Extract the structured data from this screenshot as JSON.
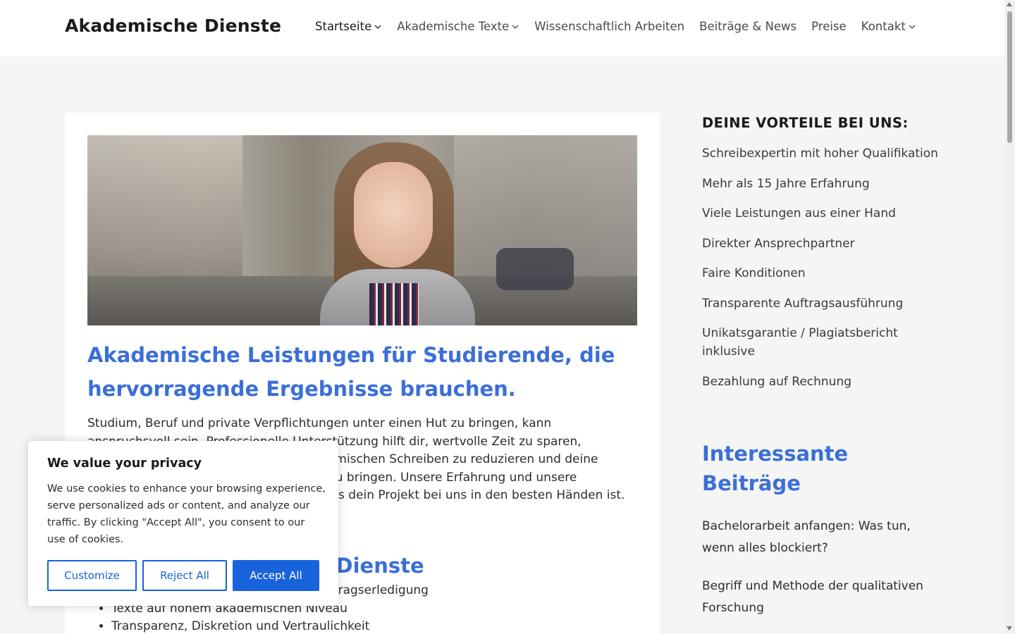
{
  "header": {
    "logo": "Akademische Dienste",
    "nav": [
      {
        "label": "Startseite",
        "has_dropdown": true,
        "active": true
      },
      {
        "label": "Akademische Texte",
        "has_dropdown": true,
        "active": false
      },
      {
        "label": "Wissenschaftlich Arbeiten",
        "has_dropdown": false,
        "active": false
      },
      {
        "label": "Beiträge & News",
        "has_dropdown": false,
        "active": false
      },
      {
        "label": "Preise",
        "has_dropdown": false,
        "active": false
      },
      {
        "label": "Kontakt",
        "has_dropdown": true,
        "active": false
      }
    ]
  },
  "main": {
    "title": "Akademische Leistungen für Studierende, die hervorragende Ergebnisse brauchen.",
    "intro": "Studium, Beruf und private Verpflichtungen unter einen Hut zu bringen, kann anspruchsvoll sein. Professionelle Unterstützung hilft dir, wertvolle Zeit zu sparen, Unsicherheiten und Schwachen im akademischen Schreiben zu reduzieren und deine Arbeit zuverlässig auf ein hohes Niveau zu bringen. Unsere Erfahrung und unsere fachkundige Begleitung sorgen dafür, dass dein Projekt bei uns in den besten Händen ist.",
    "section_heading": "Warum Akademische Dienste",
    "features": [
      "Termingerechte und zuverlässige Auftragserledigung",
      "Texte auf hohem akademischen Niveau",
      "Transparenz, Diskretion und Vertraulichkeit"
    ]
  },
  "sidebar": {
    "benefits_heading": "DEINE VORTEILE BEI UNS:",
    "benefits": [
      "Schreibexpertin mit hoher Qualifikation",
      "Mehr als 15 Jahre Erfahrung",
      "Viele Leistungen aus einer Hand",
      "Direkter Ansprechpartner",
      "Faire Konditionen",
      "Transparente Auftragsausführung",
      "Unikatsgarantie / Plagiatsbericht inklusive",
      "Bezahlung auf Rechnung"
    ],
    "posts_heading": "Interessante Beiträge",
    "posts": [
      "Bachelorarbeit anfangen: Was tun, wenn alles blockiert?",
      "Begriff und Methode der qualitativen Forschung"
    ]
  },
  "cookie_banner": {
    "title": "We value your privacy",
    "text": "We use cookies to enhance your browsing experience, serve personalized ads or content, and analyze our traffic. By clicking \"Accept All\", you consent to our use of cookies.",
    "customize_label": "Customize",
    "reject_label": "Reject All",
    "accept_label": "Accept All"
  },
  "colors": {
    "accent": "#3b6fd6",
    "button": "#1863dc",
    "page_bg": "#f5f5f5"
  },
  "icons": {
    "dropdown": "chevron-down-icon"
  }
}
